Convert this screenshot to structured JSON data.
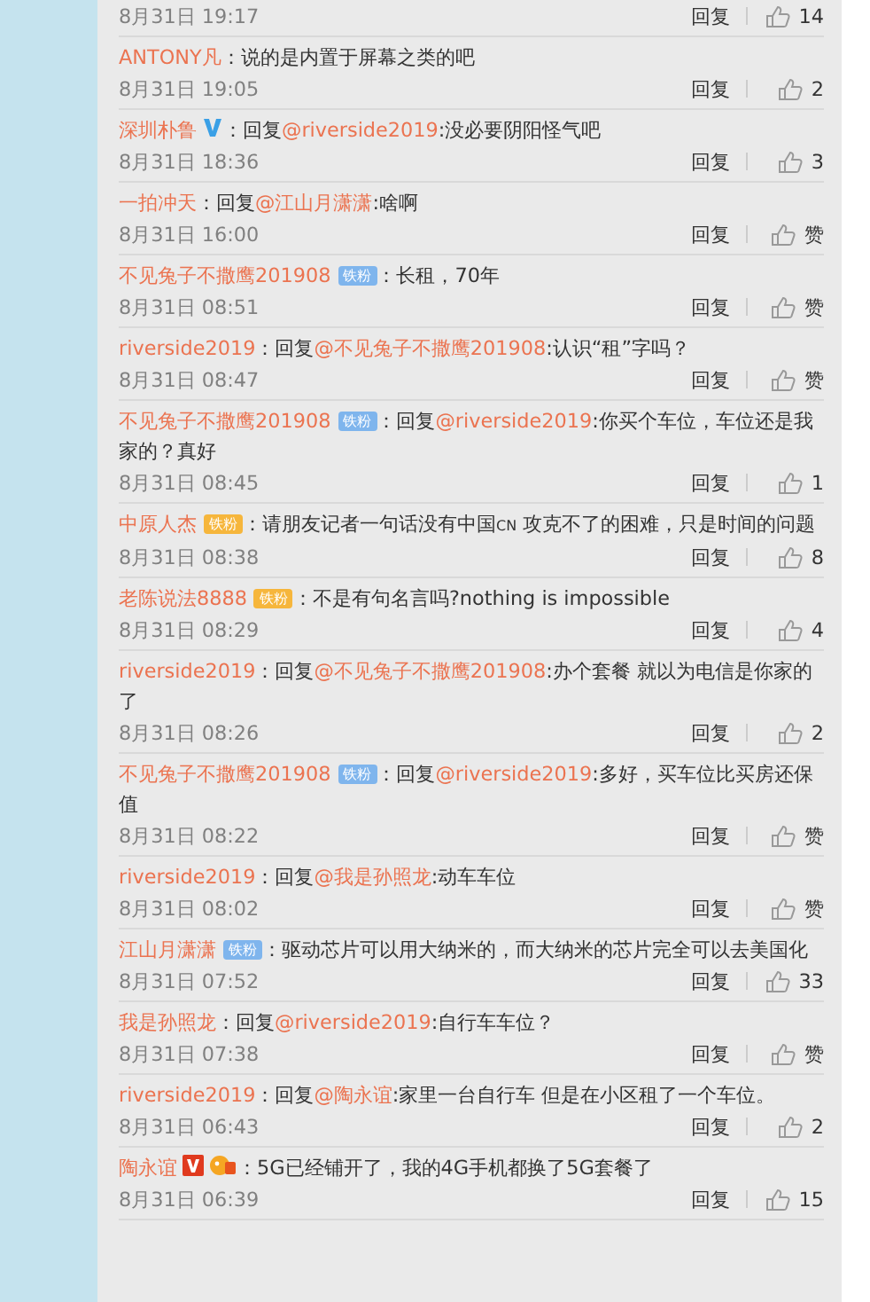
{
  "comments": [
    {
      "time": "8月31日 19:17",
      "reply": "回复",
      "likes": "14"
    },
    {
      "name": "ANTONY凡",
      "body": [
        {
          "kind": "text",
          "t": "：说的是内置于屏幕之类的吧"
        }
      ],
      "time": "8月31日 19:05",
      "reply": "回复",
      "likes": "2"
    },
    {
      "name": "深圳朴鲁",
      "badges": [
        {
          "kind": "verified-blue"
        }
      ],
      "body": [
        {
          "kind": "text",
          "t": "：回复"
        },
        {
          "kind": "mention",
          "t": "@riverside2019"
        },
        {
          "kind": "text",
          "t": ":没必要阴阳怪气吧"
        }
      ],
      "time": "8月31日 18:36",
      "reply": "回复",
      "likes": "3"
    },
    {
      "name": "一拍冲天",
      "body": [
        {
          "kind": "text",
          "t": "：回复"
        },
        {
          "kind": "mention",
          "t": "@江山月潇潇"
        },
        {
          "kind": "text",
          "t": ":啥啊"
        }
      ],
      "time": "8月31日 16:00",
      "reply": "回复",
      "likes": "赞"
    },
    {
      "name": "不见兔子不撒鹰201908",
      "badges": [
        {
          "kind": "fan-blue",
          "text": "铁粉"
        }
      ],
      "body": [
        {
          "kind": "text",
          "t": "：长租，70年"
        }
      ],
      "time": "8月31日 08:51",
      "reply": "回复",
      "likes": "赞"
    },
    {
      "name": "riverside2019",
      "body": [
        {
          "kind": "text",
          "t": "：回复"
        },
        {
          "kind": "mention",
          "t": "@不见兔子不撒鹰201908"
        },
        {
          "kind": "text",
          "t": ":认识“租”字吗？"
        }
      ],
      "time": "8月31日 08:47",
      "reply": "回复",
      "likes": "赞"
    },
    {
      "name": "不见兔子不撒鹰201908",
      "badges": [
        {
          "kind": "fan-blue",
          "text": "铁粉"
        }
      ],
      "body": [
        {
          "kind": "text",
          "t": "：回复"
        },
        {
          "kind": "mention",
          "t": "@riverside2019"
        },
        {
          "kind": "text",
          "t": ":你买个车位，车位还是我家的？真好"
        }
      ],
      "time": "8月31日 08:45",
      "reply": "回复",
      "likes": "1"
    },
    {
      "name": "中原人杰",
      "badges": [
        {
          "kind": "fan-gold",
          "text": "铁粉"
        }
      ],
      "body": [
        {
          "kind": "text",
          "t": "：请朋友记者一句话没有中国"
        },
        {
          "kind": "tag",
          "t": "CN"
        },
        {
          "kind": "text",
          "t": " 攻克不了的困难，只是时间的问题"
        }
      ],
      "time": "8月31日 08:38",
      "reply": "回复",
      "likes": "8"
    },
    {
      "name": "老陈说法8888",
      "badges": [
        {
          "kind": "fan-gold",
          "text": "铁粉"
        }
      ],
      "body": [
        {
          "kind": "text",
          "t": "：不是有句名言吗?nothing is impossible"
        }
      ],
      "time": "8月31日 08:29",
      "reply": "回复",
      "likes": "4"
    },
    {
      "name": "riverside2019",
      "body": [
        {
          "kind": "text",
          "t": "：回复"
        },
        {
          "kind": "mention",
          "t": "@不见兔子不撒鹰201908"
        },
        {
          "kind": "text",
          "t": ":办个套餐 就以为电信是你家的了"
        }
      ],
      "time": "8月31日 08:26",
      "reply": "回复",
      "likes": "2"
    },
    {
      "name": "不见兔子不撒鹰201908",
      "badges": [
        {
          "kind": "fan-blue",
          "text": "铁粉"
        }
      ],
      "body": [
        {
          "kind": "text",
          "t": "：回复"
        },
        {
          "kind": "mention",
          "t": "@riverside2019"
        },
        {
          "kind": "text",
          "t": ":多好，买车位比买房还保值"
        }
      ],
      "time": "8月31日 08:22",
      "reply": "回复",
      "likes": "赞"
    },
    {
      "name": "riverside2019",
      "body": [
        {
          "kind": "text",
          "t": "：回复"
        },
        {
          "kind": "mention",
          "t": "@我是孙照龙"
        },
        {
          "kind": "text",
          "t": ":动车车位"
        }
      ],
      "time": "8月31日 08:02",
      "reply": "回复",
      "likes": "赞"
    },
    {
      "name": "江山月潇潇",
      "badges": [
        {
          "kind": "fan-blue",
          "text": "铁粉"
        }
      ],
      "body": [
        {
          "kind": "text",
          "t": "：驱动芯片可以用大纳米的，而大纳米的芯片完全可以去美国化"
        }
      ],
      "time": "8月31日 07:52",
      "reply": "回复",
      "likes": "33"
    },
    {
      "name": "我是孙照龙",
      "body": [
        {
          "kind": "text",
          "t": "：回复"
        },
        {
          "kind": "mention",
          "t": "@riverside2019"
        },
        {
          "kind": "text",
          "t": ":自行车车位？"
        }
      ],
      "time": "8月31日 07:38",
      "reply": "回复",
      "likes": "赞"
    },
    {
      "name": "riverside2019",
      "body": [
        {
          "kind": "text",
          "t": "：回复"
        },
        {
          "kind": "mention",
          "t": "@陶永谊"
        },
        {
          "kind": "text",
          "t": ":家里一台自行车 但是在小区租了一个车位。"
        }
      ],
      "time": "8月31日 06:43",
      "reply": "回复",
      "likes": "2"
    },
    {
      "name": "陶永谊",
      "badges": [
        {
          "kind": "verified-orange"
        },
        {
          "kind": "member-gold"
        }
      ],
      "body": [
        {
          "kind": "text",
          "t": "：5G已经铺开了，我的4G手机都换了5G套餐了"
        }
      ],
      "time": "8月31日 06:39",
      "reply": "回复",
      "likes": "15"
    }
  ]
}
